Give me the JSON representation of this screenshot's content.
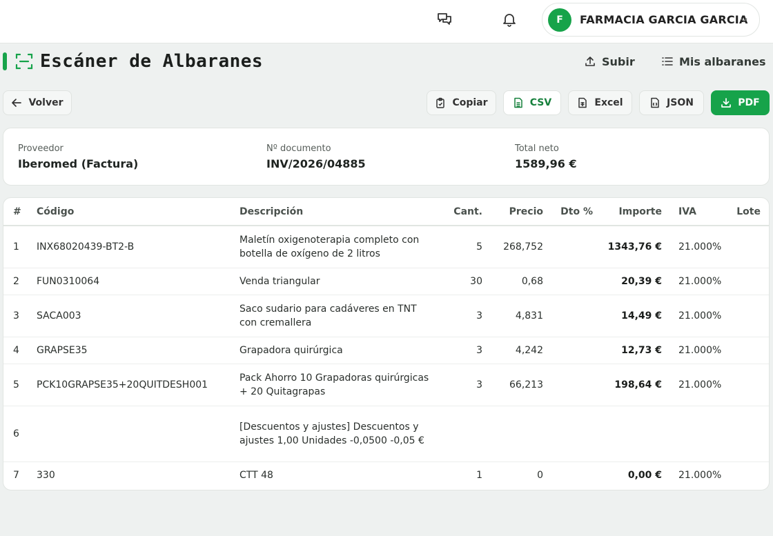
{
  "topbar": {
    "chat_icon": "chat-bubbles-icon",
    "bell_icon": "bell-icon",
    "user": {
      "initial": "F",
      "name": "FARMACIA GARCIA GARCIA"
    }
  },
  "header": {
    "title": "Escáner de Albaranes",
    "upload_label": "Subir",
    "my_docs_label": "Mis albaranes"
  },
  "toolbar": {
    "back_label": "Volver",
    "copy_label": "Copiar",
    "csv_label": "CSV",
    "excel_label": "Excel",
    "json_label": "JSON",
    "pdf_label": "PDF"
  },
  "summary": {
    "supplier_label": "Proveedor",
    "supplier_value": "Iberomed (Factura)",
    "doc_label": "Nº documento",
    "doc_value": "INV/2026/04885",
    "total_label": "Total neto",
    "total_value": "1589,96 €"
  },
  "table": {
    "headers": {
      "num": "#",
      "code": "Código",
      "desc": "Descripción",
      "qty": "Cant.",
      "price": "Precio",
      "disc": "Dto %",
      "amount": "Importe",
      "vat": "IVA",
      "lot": "Lote"
    },
    "rows": [
      {
        "num": "1",
        "code": "INX68020439-BT2-B",
        "desc": "Maletín oxigenoterapia completo con botella de oxígeno de 2 litros",
        "qty": "5",
        "price": "268,752",
        "disc": "",
        "amount": "1343,76 €",
        "vat": "21.000%",
        "lot": ""
      },
      {
        "num": "2",
        "code": "FUN0310064",
        "desc": "Venda triangular",
        "qty": "30",
        "price": "0,68",
        "disc": "",
        "amount": "20,39 €",
        "vat": "21.000%",
        "lot": ""
      },
      {
        "num": "3",
        "code": "SACA003",
        "desc": "Saco sudario para cadáveres en TNT con cremallera",
        "qty": "3",
        "price": "4,831",
        "disc": "",
        "amount": "14,49 €",
        "vat": "21.000%",
        "lot": ""
      },
      {
        "num": "4",
        "code": "GRAPSE35",
        "desc": "Grapadora quirúrgica",
        "qty": "3",
        "price": "4,242",
        "disc": "",
        "amount": "12,73 €",
        "vat": "21.000%",
        "lot": ""
      },
      {
        "num": "5",
        "code": "PCK10GRAPSE35+20QUITDESH001",
        "desc": "Pack Ahorro 10 Grapadoras quirúrgicas + 20 Quitagrapas",
        "qty": "3",
        "price": "66,213",
        "disc": "",
        "amount": "198,64 €",
        "vat": "21.000%",
        "lot": ""
      },
      {
        "num": "6",
        "code": "",
        "desc": "[Descuentos y ajustes] Descuentos y ajustes 1,00 Unidades -0,0500 -0,05 €",
        "qty": "",
        "price": "",
        "disc": "",
        "amount": "",
        "vat": "",
        "lot": ""
      },
      {
        "num": "7",
        "code": "330",
        "desc": "CTT 48",
        "qty": "1",
        "price": "0",
        "disc": "",
        "amount": "0,00 €",
        "vat": "21.000%",
        "lot": ""
      }
    ]
  },
  "colors": {
    "accent": "#16a34a",
    "background": "#eef1f0"
  }
}
